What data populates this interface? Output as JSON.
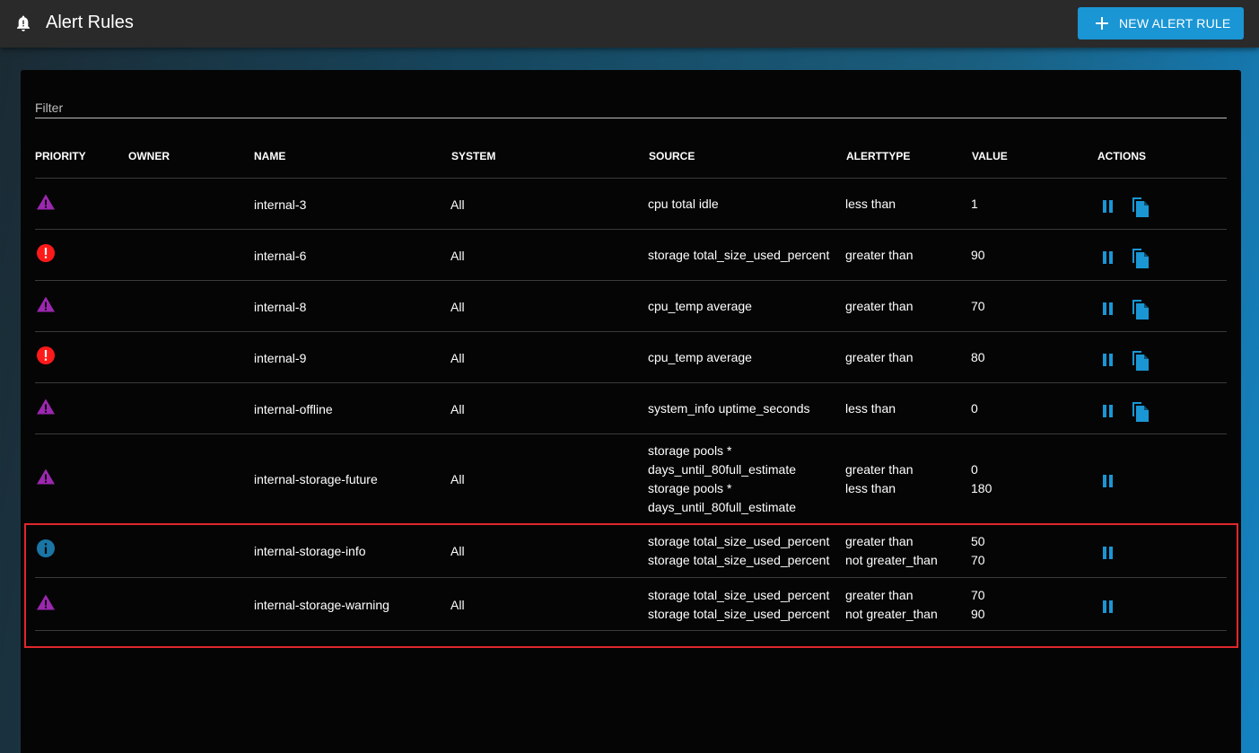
{
  "header": {
    "title": "Alert Rules",
    "new_button": "NEW ALERT RULE"
  },
  "filter": {
    "placeholder": "Filter"
  },
  "columns": {
    "priority": "PRIORITY",
    "owner": "OWNER",
    "name": "NAME",
    "system": "SYSTEM",
    "source": "SOURCE",
    "alerttype": "ALERTTYPE",
    "value": "VALUE",
    "actions": "ACTIONS"
  },
  "colors": {
    "warning": "#9c27b0",
    "error": "#ff1a1a",
    "info": "#1976a5",
    "accent": "#1a96d5",
    "highlight": "#e0262d"
  },
  "rows": [
    {
      "priority": "warning-icon",
      "name": "internal-3",
      "system": "All",
      "sources": [
        "cpu total idle"
      ],
      "alerttypes": [
        "less than"
      ],
      "values": [
        "1"
      ],
      "copy": true
    },
    {
      "priority": "error-icon",
      "name": "internal-6",
      "system": "All",
      "sources": [
        "storage total_size_used_percent"
      ],
      "alerttypes": [
        "greater than"
      ],
      "values": [
        "90"
      ],
      "copy": true
    },
    {
      "priority": "warning-icon",
      "name": "internal-8",
      "system": "All",
      "sources": [
        "cpu_temp average"
      ],
      "alerttypes": [
        "greater than"
      ],
      "values": [
        "70"
      ],
      "copy": true
    },
    {
      "priority": "error-icon",
      "name": "internal-9",
      "system": "All",
      "sources": [
        "cpu_temp average"
      ],
      "alerttypes": [
        "greater than"
      ],
      "values": [
        "80"
      ],
      "copy": true
    },
    {
      "priority": "warning-icon",
      "name": "internal-offline",
      "system": "All",
      "sources": [
        "system_info uptime_seconds"
      ],
      "alerttypes": [
        "less than"
      ],
      "values": [
        "0"
      ],
      "copy": true
    },
    {
      "priority": "warning-icon",
      "name": "internal-storage-future",
      "system": "All",
      "sources": [
        "storage pools *",
        "days_until_80full_estimate",
        "storage pools *",
        "days_until_80full_estimate"
      ],
      "alerttypes": [
        "greater than",
        "less than"
      ],
      "values": [
        "0",
        "180"
      ],
      "copy": false
    },
    {
      "priority": "info-icon",
      "name": "internal-storage-info",
      "system": "All",
      "sources": [
        "storage total_size_used_percent",
        "storage total_size_used_percent"
      ],
      "alerttypes": [
        "greater than",
        "not greater_than"
      ],
      "values": [
        "50",
        "70"
      ],
      "copy": false
    },
    {
      "priority": "warning-icon",
      "name": "internal-storage-warning",
      "system": "All",
      "sources": [
        "storage total_size_used_percent",
        "storage total_size_used_percent"
      ],
      "alerttypes": [
        "greater than",
        "not greater_than"
      ],
      "values": [
        "70",
        "90"
      ],
      "copy": false
    }
  ]
}
